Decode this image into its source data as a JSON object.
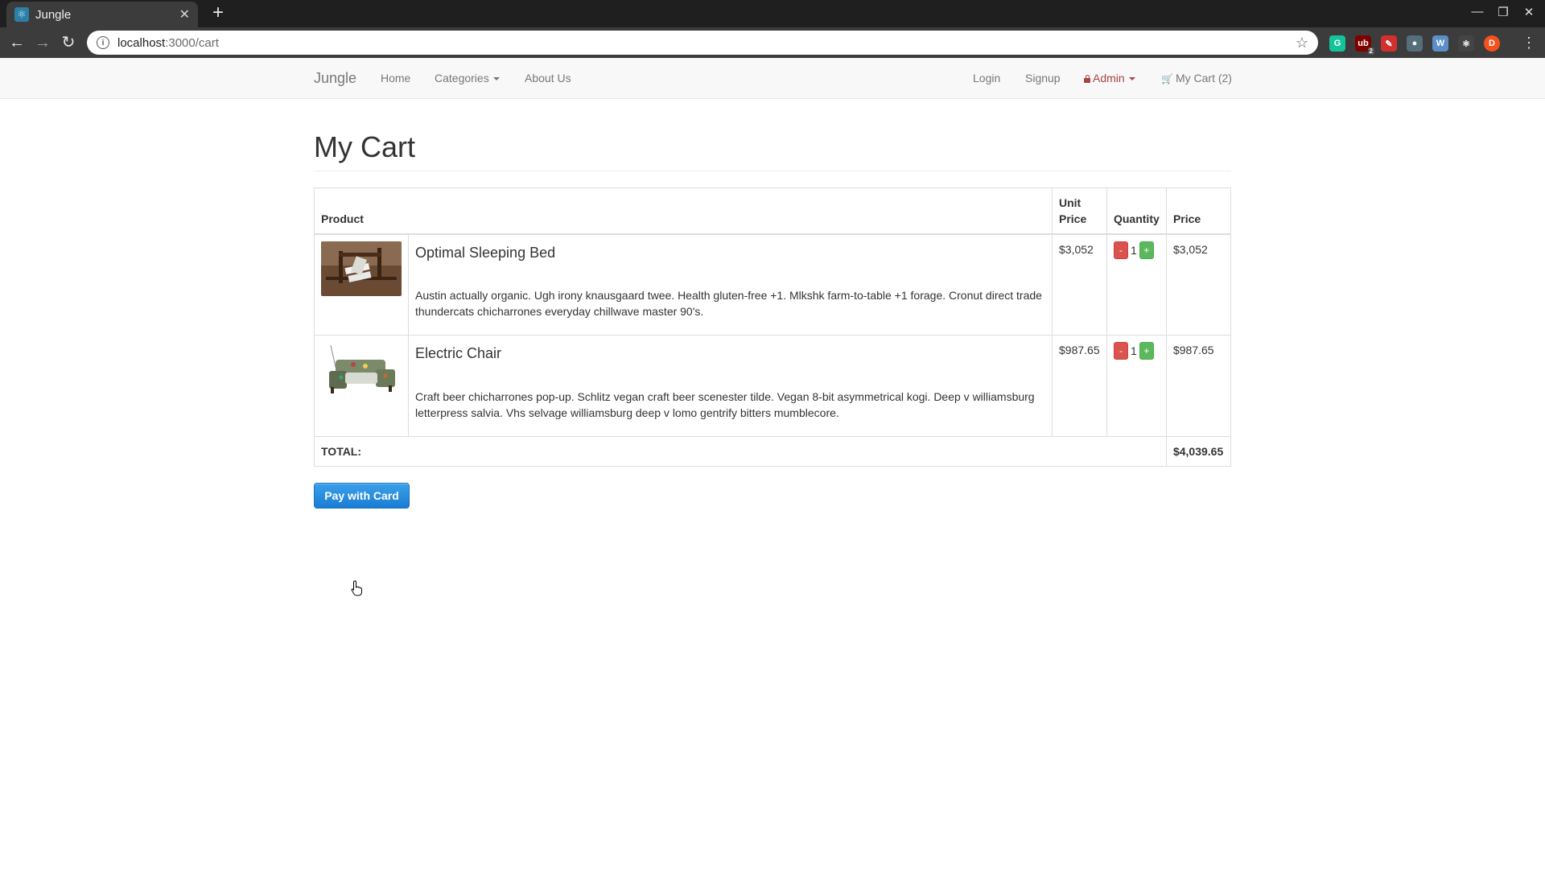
{
  "browser": {
    "tab_title": "Jungle",
    "url_host": "localhost",
    "url_path": ":3000/cart",
    "extensions": [
      {
        "name": "grammarly-extension-icon",
        "label": "G",
        "color": "#15c39a"
      },
      {
        "name": "ublock-extension-icon",
        "label": "ub",
        "badge": "2",
        "color": "#800000"
      },
      {
        "name": "pdf-extension-icon",
        "label": "✎",
        "color": "#d32f2f"
      },
      {
        "name": "circle-extension-icon",
        "label": "●",
        "color": "#546e7a"
      },
      {
        "name": "wappalyzer-extension-icon",
        "label": "W",
        "color": "#5b8fc7"
      },
      {
        "name": "react-devtools-extension-icon",
        "label": "⚛",
        "color": "#444444"
      },
      {
        "name": "profile-avatar",
        "label": "D",
        "color": "#f4511e"
      }
    ]
  },
  "navbar": {
    "brand": "Jungle",
    "home": "Home",
    "categories": "Categories",
    "about": "About Us",
    "login": "Login",
    "signup": "Signup",
    "admin": "Admin",
    "cart": "My Cart (2)"
  },
  "page": {
    "title": "My Cart"
  },
  "cart": {
    "headers": {
      "product": "Product",
      "unit_price": "Unit Price",
      "quantity": "Quantity",
      "price": "Price"
    },
    "items": [
      {
        "name": "Optimal Sleeping Bed",
        "description": "Austin actually organic. Ugh irony knausgaard twee. Health gluten-free +1. Mlkshk farm-to-table +1 forage. Cronut direct trade thundercats chicharrones everyday chillwave master 90's.",
        "unit_price": "$3,052",
        "minus": "-",
        "quantity": "1",
        "plus": "+",
        "price": "$3,052"
      },
      {
        "name": "Electric Chair",
        "description": "Craft beer chicharrones pop-up. Schlitz vegan craft beer scenester tilde. Vegan 8-bit asymmetrical kogi. Deep v williamsburg letterpress salvia. Vhs selvage williamsburg deep v lomo gentrify bitters mumblecore.",
        "unit_price": "$987.65",
        "minus": "-",
        "quantity": "1",
        "plus": "+",
        "price": "$987.65"
      }
    ],
    "total_label": "TOTAL:",
    "total_value": "$4,039.65"
  },
  "pay_button": "Pay with Card"
}
